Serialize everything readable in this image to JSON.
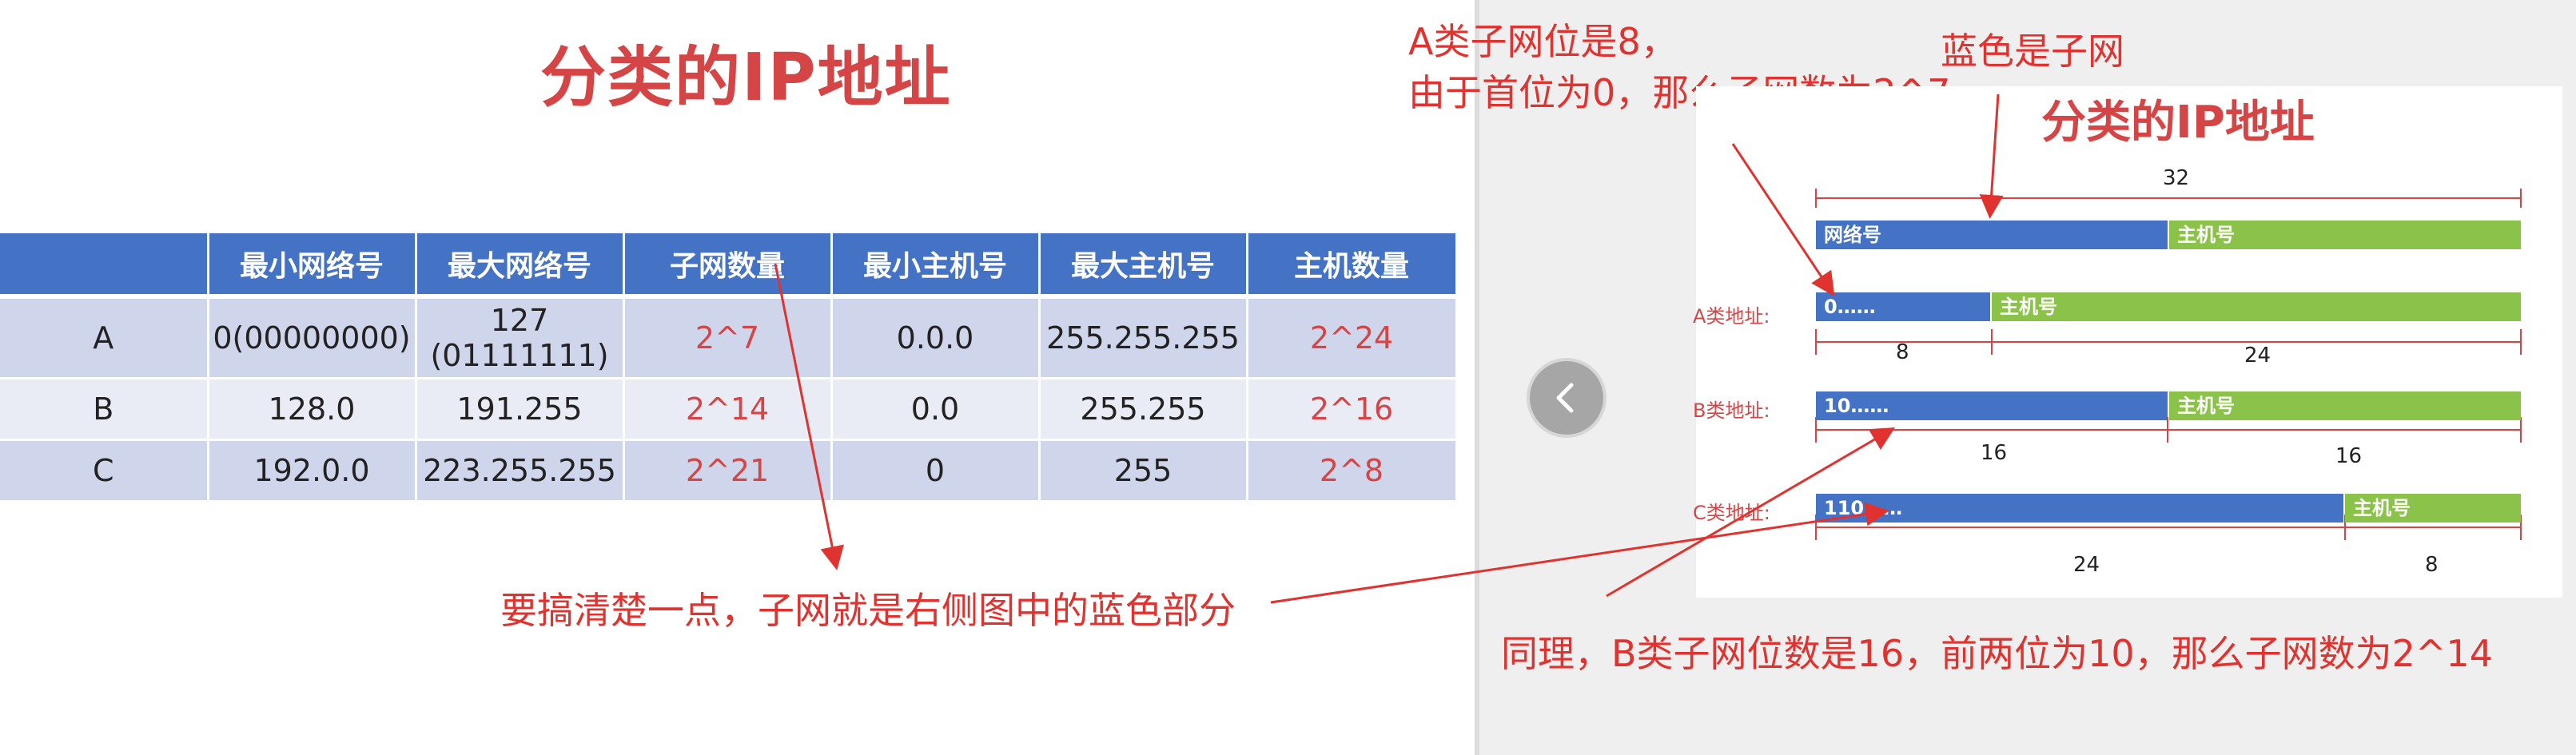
{
  "left": {
    "title": "分类的IP地址",
    "table": {
      "headers": [
        "",
        "最小网络号",
        "最大网络号",
        "子网数量",
        "最小主机号",
        "最大主机号",
        "主机数量"
      ],
      "rows": [
        {
          "cls": "A",
          "min_net": "0(00000000)",
          "max_net_line1": "127",
          "max_net_line2": "(01111111)",
          "subnets": "2^7",
          "min_host": "0.0.0",
          "max_host": "255.255.255",
          "hosts": "2^24"
        },
        {
          "cls": "B",
          "min_net": "128.0",
          "max_net_line1": "191.255",
          "subnets": "2^14",
          "min_host": "0.0",
          "max_host": "255.255",
          "hosts": "2^16"
        },
        {
          "cls": "C",
          "min_net": "192.0.0",
          "max_net_line1": "223.255.255",
          "subnets": "2^21",
          "min_host": "0",
          "max_host": "255",
          "hosts": "2^8"
        }
      ]
    },
    "note": "要搞清楚一点，子网就是右侧图中的蓝色部分"
  },
  "right": {
    "note_a_line1": "A类子网位是8，",
    "note_a_line2": "由于首位为0，那么子网数为2^7",
    "note_blue": "蓝色是子网",
    "note_b": "同理，B类子网位数是16，前两位为10，那么子网数为2^14",
    "diagram": {
      "title": "分类的IP地址",
      "total_bits": "32",
      "header_net": "网络号",
      "header_host": "主机号",
      "a_label": "A类地址:",
      "a_net": "0……",
      "a_host": "主机号",
      "a_net_bits": "8",
      "a_host_bits": "24",
      "b_label": "B类地址:",
      "b_net": "10……",
      "b_host": "主机号",
      "b_net_bits": "16",
      "b_host_bits": "16",
      "c_label": "C类地址:",
      "c_net": "110……",
      "c_host": "主机号",
      "c_net_bits": "24",
      "c_host_bits": "8"
    }
  },
  "colors": {
    "accent_red": "#e0332f",
    "header_blue": "#4472c4",
    "host_green": "#8bc34a"
  },
  "icons": {
    "back": "chevron-left-icon"
  }
}
